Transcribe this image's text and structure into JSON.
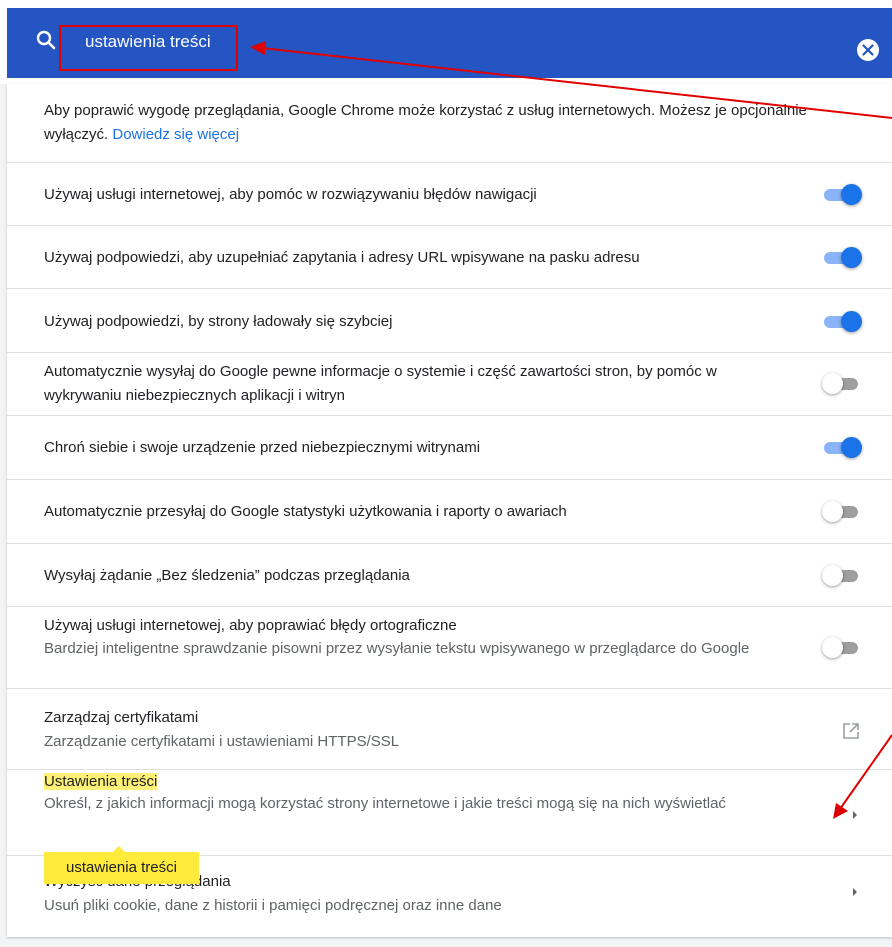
{
  "search": {
    "query": "ustawienia treści",
    "icon": "search-icon",
    "clear_icon": "close-icon",
    "bar_color": "#2455c3"
  },
  "intro": {
    "text": "Aby poprawić wygodę przeglądania, Google Chrome może korzystać z usług internetowych. Możesz je opcjonalnie wyłączyć.",
    "link": "Dowiedz się więcej"
  },
  "settings": [
    {
      "label": "Używaj usługi internetowej, aby pomóc w rozwiązywaniu błędów nawigacji",
      "state": "on"
    },
    {
      "label": "Używaj podpowiedzi, aby uzupełniać zapytania i adresy URL wpisywane na pasku adresu",
      "state": "on"
    },
    {
      "label": "Używaj podpowiedzi, by strony ładowały się szybciej",
      "state": "on"
    },
    {
      "label": "Automatycznie wysyłaj do Google pewne informacje o systemie i część zawartości stron, by pomóc w wykrywaniu niebezpiecznych aplikacji i witryn",
      "state": "off"
    },
    {
      "label": "Chroń siebie i swoje urządzenie przed niebezpiecznymi witrynami",
      "state": "on"
    },
    {
      "label": "Automatycznie przesyłaj do Google statystyki użytkowania i raporty o awariach",
      "state": "off"
    },
    {
      "label": "Wysyłaj żądanie „Bez śledzenia” podczas przeglądania",
      "state": "off"
    },
    {
      "label": "Używaj usługi internetowej, aby poprawiać błędy ortograficzne",
      "sublabel": "Bardziej inteligentne sprawdzanie pisowni przez wysyłanie tekstu wpisywanego w przeglądarce do Google",
      "state": "off"
    }
  ],
  "certificates": {
    "label": "Zarządzaj certyfikatami",
    "sublabel": "Zarządzanie certyfikatami i ustawieniami HTTPS/SSL",
    "icon": "open-in-new-icon"
  },
  "content_settings": {
    "label": "Ustawienia treści",
    "sublabel": "Określ, z jakich informacji mogą korzystać strony internetowe i jakie treści mogą się na nich wyświetlać",
    "icon": "chevron-right-icon"
  },
  "clear_data": {
    "label": "Wyczyść dane przeglądania",
    "sublabel": "Usuń pliki cookie, dane z historii i pamięci podręcznej oraz inne dane",
    "icon": "chevron-right-icon"
  },
  "tooltip": {
    "text": "ustawienia treści"
  },
  "colors": {
    "toggle_on": "#1a73e8",
    "toggle_off_track": "#9e9e9e",
    "highlight": "#fff176",
    "annotation": "#e00000"
  }
}
